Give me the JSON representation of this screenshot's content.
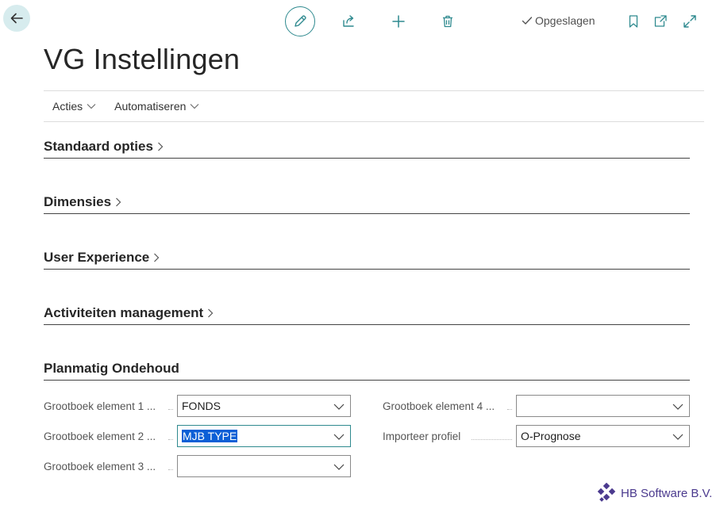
{
  "header": {
    "saved_label": "Opgeslagen"
  },
  "page": {
    "title": "VG Instellingen"
  },
  "actions": [
    {
      "label": "Acties"
    },
    {
      "label": "Automatiseren"
    }
  ],
  "sections": [
    {
      "title": "Standaard opties"
    },
    {
      "title": "Dimensies"
    },
    {
      "title": "User Experience"
    },
    {
      "title": "Activiteiten management"
    },
    {
      "title": "Planmatig Ondehoud"
    }
  ],
  "fields": {
    "left": [
      {
        "label": "Grootboek element 1 ...",
        "value": "FONDS"
      },
      {
        "label": "Grootboek element 2 ...",
        "value": "MJB TYPE"
      },
      {
        "label": "Grootboek element 3 ...",
        "value": ""
      }
    ],
    "right": [
      {
        "label": "Grootboek element 4 ...",
        "value": ""
      },
      {
        "label": "Importeer profiel",
        "value": "O-Prognose"
      }
    ]
  },
  "footer": {
    "company": "HB Software B.V."
  },
  "colors": {
    "accent": "#2f8a8f",
    "back_button_bg": "#d7ecee",
    "selection": "#0b5fd6",
    "logo": "#4b3a8e"
  },
  "icons": [
    "back-arrow-icon",
    "pencil-icon",
    "share-icon",
    "plus-icon",
    "trash-icon",
    "checkmark-icon",
    "bookmark-icon",
    "open-new-window-icon",
    "expand-icon",
    "chevron-down-icon",
    "chevron-right-icon",
    "hb-logo-icon"
  ]
}
